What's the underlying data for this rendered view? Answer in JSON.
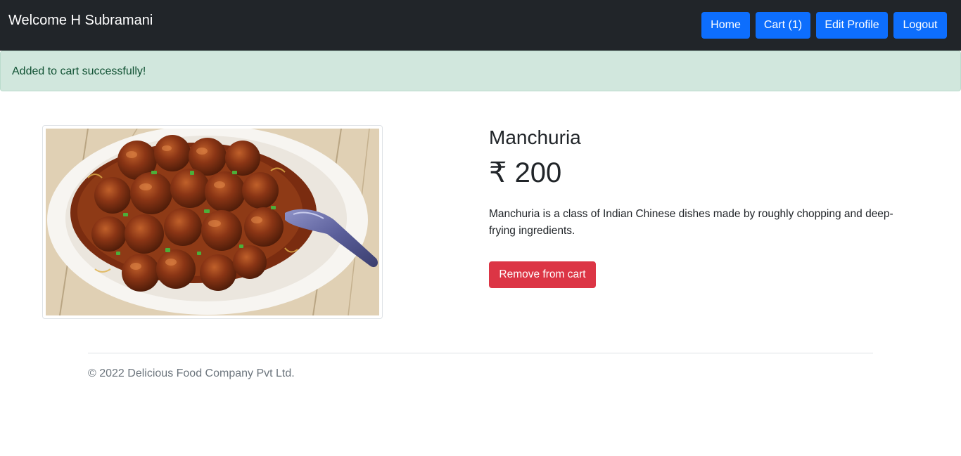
{
  "navbar": {
    "brand": "Welcome H Subramani",
    "buttons": {
      "home": "Home",
      "cart": "Cart (1)",
      "edit_profile": "Edit Profile",
      "logout": "Logout"
    }
  },
  "alert": {
    "message": "Added to cart successfully!"
  },
  "product": {
    "name": "Manchuria",
    "price": "₹ 200",
    "description": "Manchuria is a class of Indian Chinese dishes made by roughly chopping and deep-frying ingredients.",
    "remove_button": "Remove from cart"
  },
  "footer": {
    "copyright": "© 2022 Delicious Food Company Pvt Ltd."
  },
  "colors": {
    "navbar_bg": "#212529",
    "primary": "#0d6efd",
    "danger": "#dc3545",
    "success_bg": "#d1e7dd",
    "success_text": "#0f5132"
  }
}
